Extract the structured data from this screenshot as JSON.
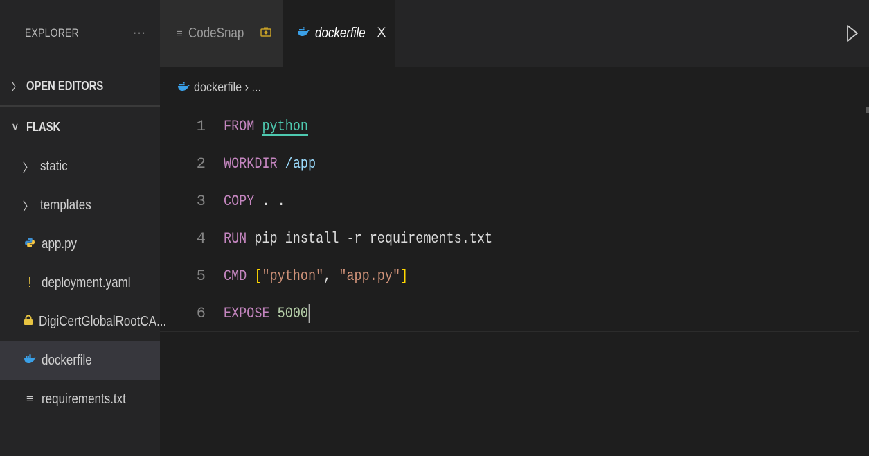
{
  "sidebar": {
    "title": "EXPLORER",
    "menu": "···",
    "open_editors": "OPEN EDITORS",
    "folder": "FLASK",
    "items": [
      {
        "label": "static",
        "type": "folder"
      },
      {
        "label": "templates",
        "type": "folder"
      },
      {
        "label": "app.py",
        "type": "python"
      },
      {
        "label": "deployment.yaml",
        "type": "yaml"
      },
      {
        "label": "DigiCertGlobalRootCA...",
        "type": "certificate"
      },
      {
        "label": "dockerfile",
        "type": "docker"
      },
      {
        "label": "requirements.txt",
        "type": "text"
      }
    ]
  },
  "tabs": [
    {
      "label": "CodeSnap",
      "icon": "lines-icon",
      "active": false
    },
    {
      "label": "dockerfile",
      "icon": "docker-icon",
      "active": true,
      "close": "X"
    }
  ],
  "breadcrumb": {
    "file": "dockerfile",
    "rest": "› ..."
  },
  "code": {
    "lines": [
      {
        "n": "1",
        "parts": [
          {
            "t": "FROM ",
            "c": "kw"
          },
          {
            "t": "python",
            "c": "name"
          }
        ]
      },
      {
        "n": "2",
        "parts": [
          {
            "t": "WORKDIR ",
            "c": "kw"
          },
          {
            "t": "/app",
            "c": "path"
          }
        ]
      },
      {
        "n": "3",
        "parts": [
          {
            "t": "COPY ",
            "c": "kw"
          },
          {
            "t": ". .",
            "c": "plain"
          }
        ]
      },
      {
        "n": "4",
        "parts": [
          {
            "t": "RUN ",
            "c": "kw"
          },
          {
            "t": "pip install -r requirements.txt",
            "c": "plain"
          }
        ]
      },
      {
        "n": "5",
        "parts": [
          {
            "t": "CMD ",
            "c": "kw"
          },
          {
            "t": "[",
            "c": "brk"
          },
          {
            "t": "\"python\"",
            "c": "str"
          },
          {
            "t": ", ",
            "c": "plain"
          },
          {
            "t": "\"app.py\"",
            "c": "str"
          },
          {
            "t": "]",
            "c": "brk"
          }
        ]
      },
      {
        "n": "6",
        "parts": [
          {
            "t": "EXPOSE ",
            "c": "kw"
          },
          {
            "t": "5000",
            "c": "num"
          }
        ]
      }
    ]
  },
  "colors": {
    "background": "#1e1e1e",
    "sidebar": "#252526",
    "keyword": "#c586c0",
    "type_name": "#4ec9b0",
    "string": "#ce9178",
    "number": "#b5cea8",
    "docker_blue": "#3aa0e8"
  }
}
